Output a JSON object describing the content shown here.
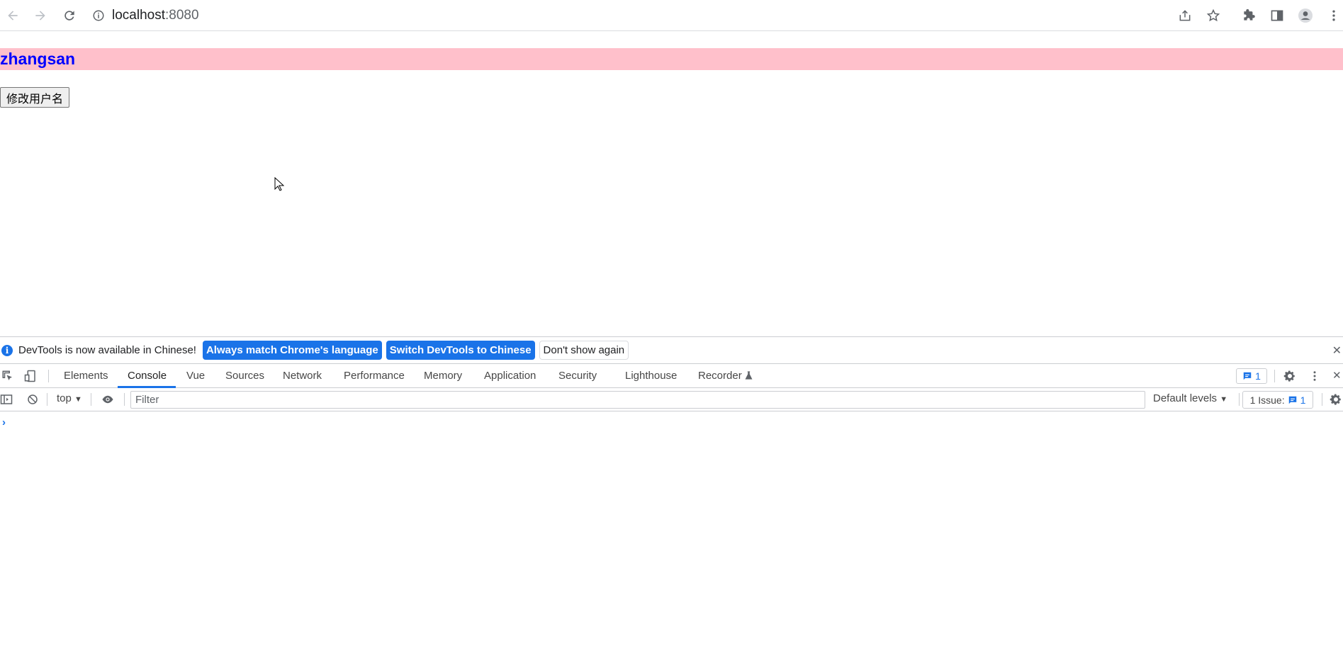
{
  "browser": {
    "url_host": "localhost",
    "url_port": ":8080"
  },
  "page": {
    "username": "zhangsan",
    "change_button_label": "修改用户名"
  },
  "devtools": {
    "infobar": {
      "message": "DevTools is now available in Chinese!",
      "always_match": "Always match Chrome's language",
      "switch": "Switch DevTools to Chinese",
      "dont_show": "Don't show again"
    },
    "tabs": [
      "Elements",
      "Console",
      "Vue",
      "Sources",
      "Network",
      "Performance",
      "Memory",
      "Application",
      "Security",
      "Lighthouse",
      "Recorder"
    ],
    "active_tab": "Console",
    "message_count": "1",
    "console": {
      "context": "top",
      "filter_placeholder": "Filter",
      "levels": "Default levels",
      "issues_label": "1 Issue:",
      "issues_count": "1",
      "prompt": "›"
    }
  },
  "colors": {
    "name_bar_bg": "#ffc0cb",
    "name_text": "#0000ff",
    "accent": "#1a73e8"
  }
}
